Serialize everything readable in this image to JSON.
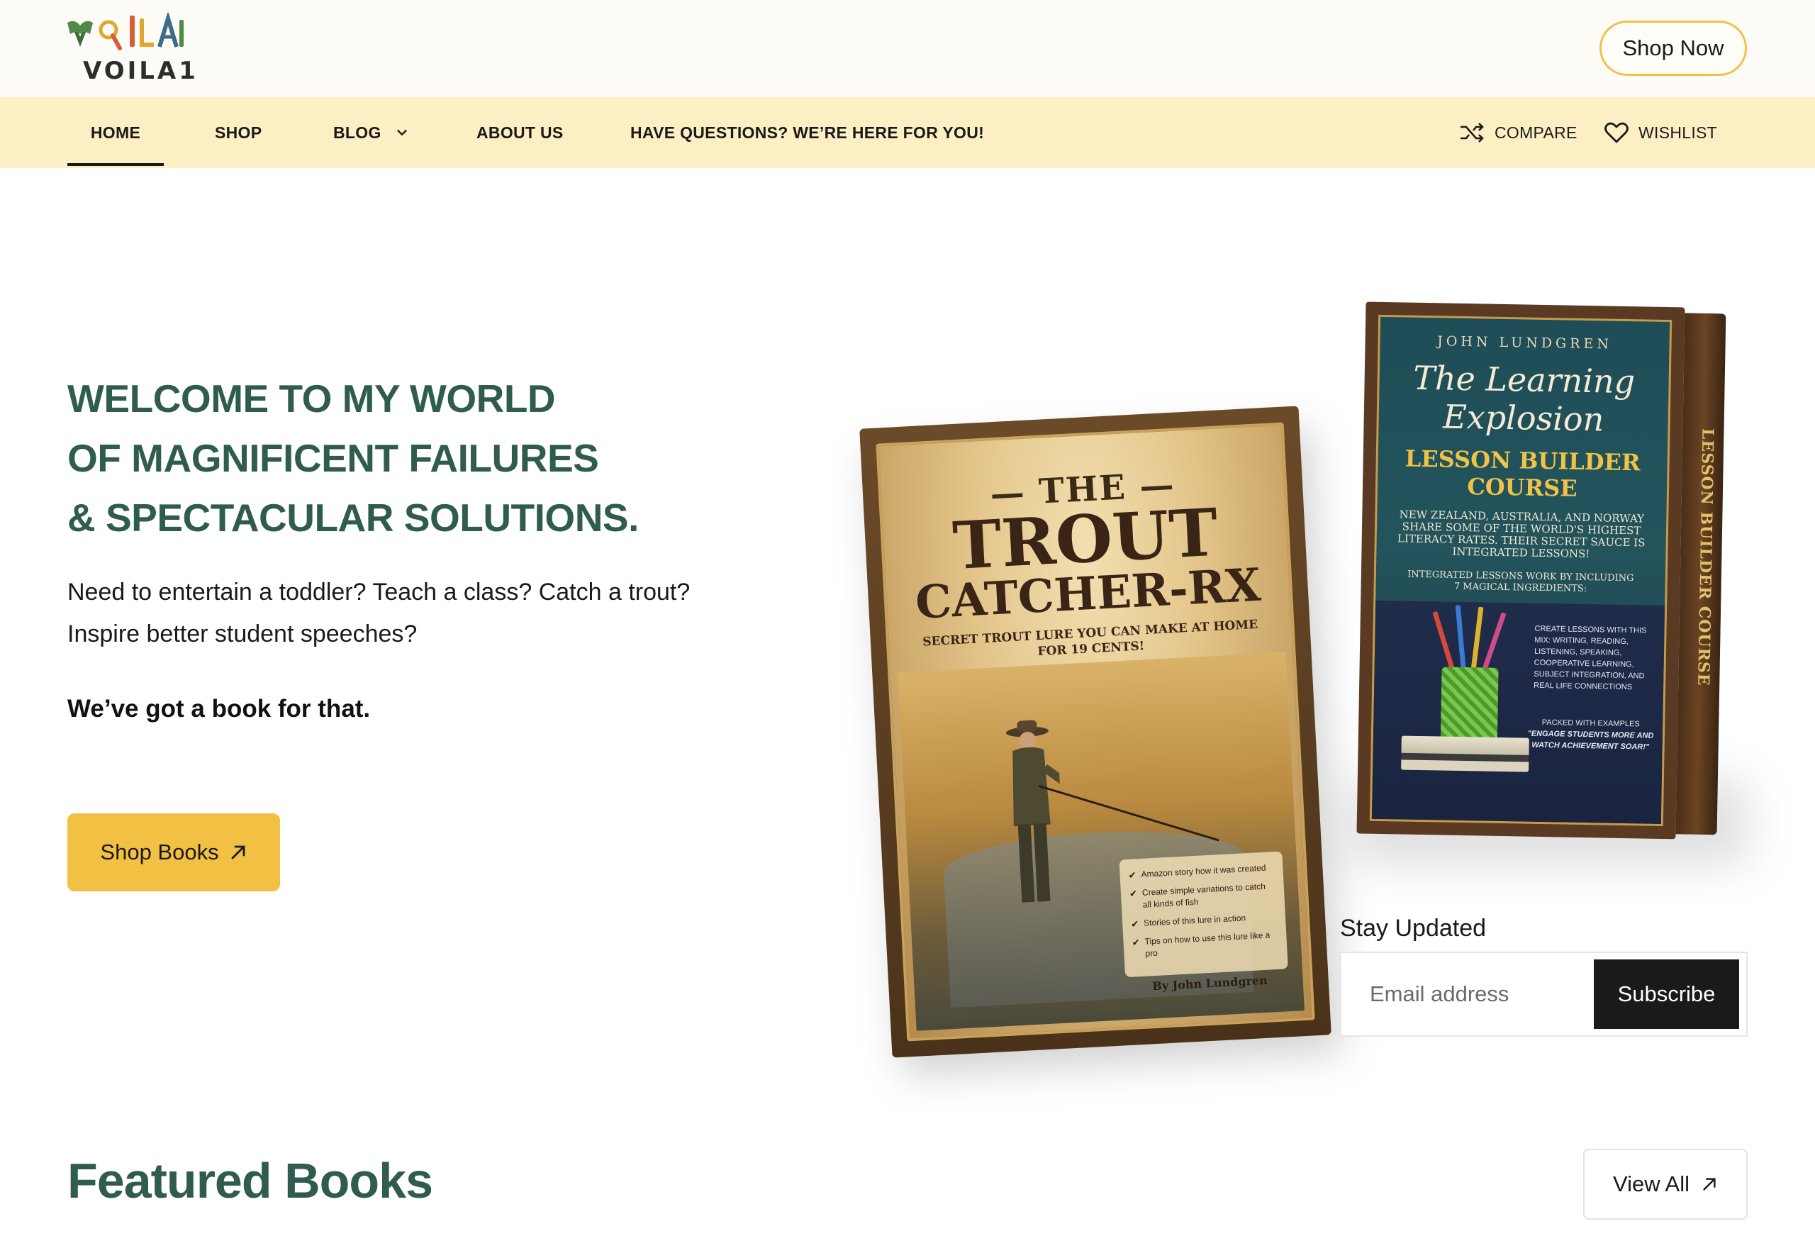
{
  "brand": {
    "logo_text": "VOILA1"
  },
  "header": {
    "shop_now_label": "Shop Now"
  },
  "nav": {
    "items": [
      {
        "label": "HOME"
      },
      {
        "label": "SHOP"
      },
      {
        "label": "BLOG"
      },
      {
        "label": "ABOUT US"
      },
      {
        "label": "HAVE QUESTIONS? WE’RE HERE FOR YOU!"
      }
    ],
    "active": "HOME",
    "compare_label": "COMPARE",
    "wishlist_label": "WISHLIST"
  },
  "hero": {
    "title_lines": [
      "WELCOME TO MY WORLD",
      "OF MAGNIFICENT FAILURES",
      "& SPECTACULAR SOLUTIONS."
    ],
    "body_lines": [
      "Need to entertain a toddler? Teach a class? Catch a trout?",
      "Inspire better student speeches?"
    ],
    "tagline": "We’ve got a book for that.",
    "cta_label": "Shop Books"
  },
  "books": {
    "trout": {
      "the": "— THE —",
      "title1": "TROUT",
      "title2": "CATCHER-RX",
      "subtitle": "SECRET TROUT LURE YOU CAN MAKE AT HOME FOR 19 CENTS!",
      "checks": [
        "Amazon story how it was created",
        "Create simple variations to catch all kinds of fish",
        "Stories of this lure in action",
        "Tips on how to use this lure like a pro"
      ],
      "author": "By John Lundgren"
    },
    "learning": {
      "author": "JOHN LUNDGREN",
      "title1": "The Learning",
      "title2": "Explosion",
      "course1": "LESSON BUILDER",
      "course2": "COURSE",
      "desc": "NEW ZEALAND, AUSTRALIA, AND NORWAY SHARE SOME OF THE WORLD'S HIGHEST LITERACY RATES. THEIR SECRET SAUCE IS INTEGRATED LESSONS!",
      "desc2": "INTEGRATED LESSONS WORK BY INCLUDING 7 MAGICAL INGREDIENTS:",
      "lower_text": "CREATE LESSONS WITH THIS MIX: WRITING, READING, LISTENING, SPEAKING, COOPERATIVE LEARNING, SUBJECT INTEGRATION, AND REAL LIFE CONNECTIONS",
      "lower_packed": "PACKED WITH EXAMPLES",
      "lower_quote": "\"ENGAGE STUDENTS MORE AND WATCH ACHIEVEMENT SOAR!\"",
      "spine": "LESSON BUILDER COURSE"
    }
  },
  "newsletter": {
    "title": "Stay Updated",
    "placeholder": "Email address",
    "button_label": "Subscribe"
  },
  "featured": {
    "title": "Featured Books",
    "view_all_label": "View All"
  },
  "colors": {
    "accent_yellow": "#f2c042",
    "nav_bg": "#fdefc4",
    "heading_green": "#2f5c4f",
    "dark": "#1a1a1a"
  }
}
